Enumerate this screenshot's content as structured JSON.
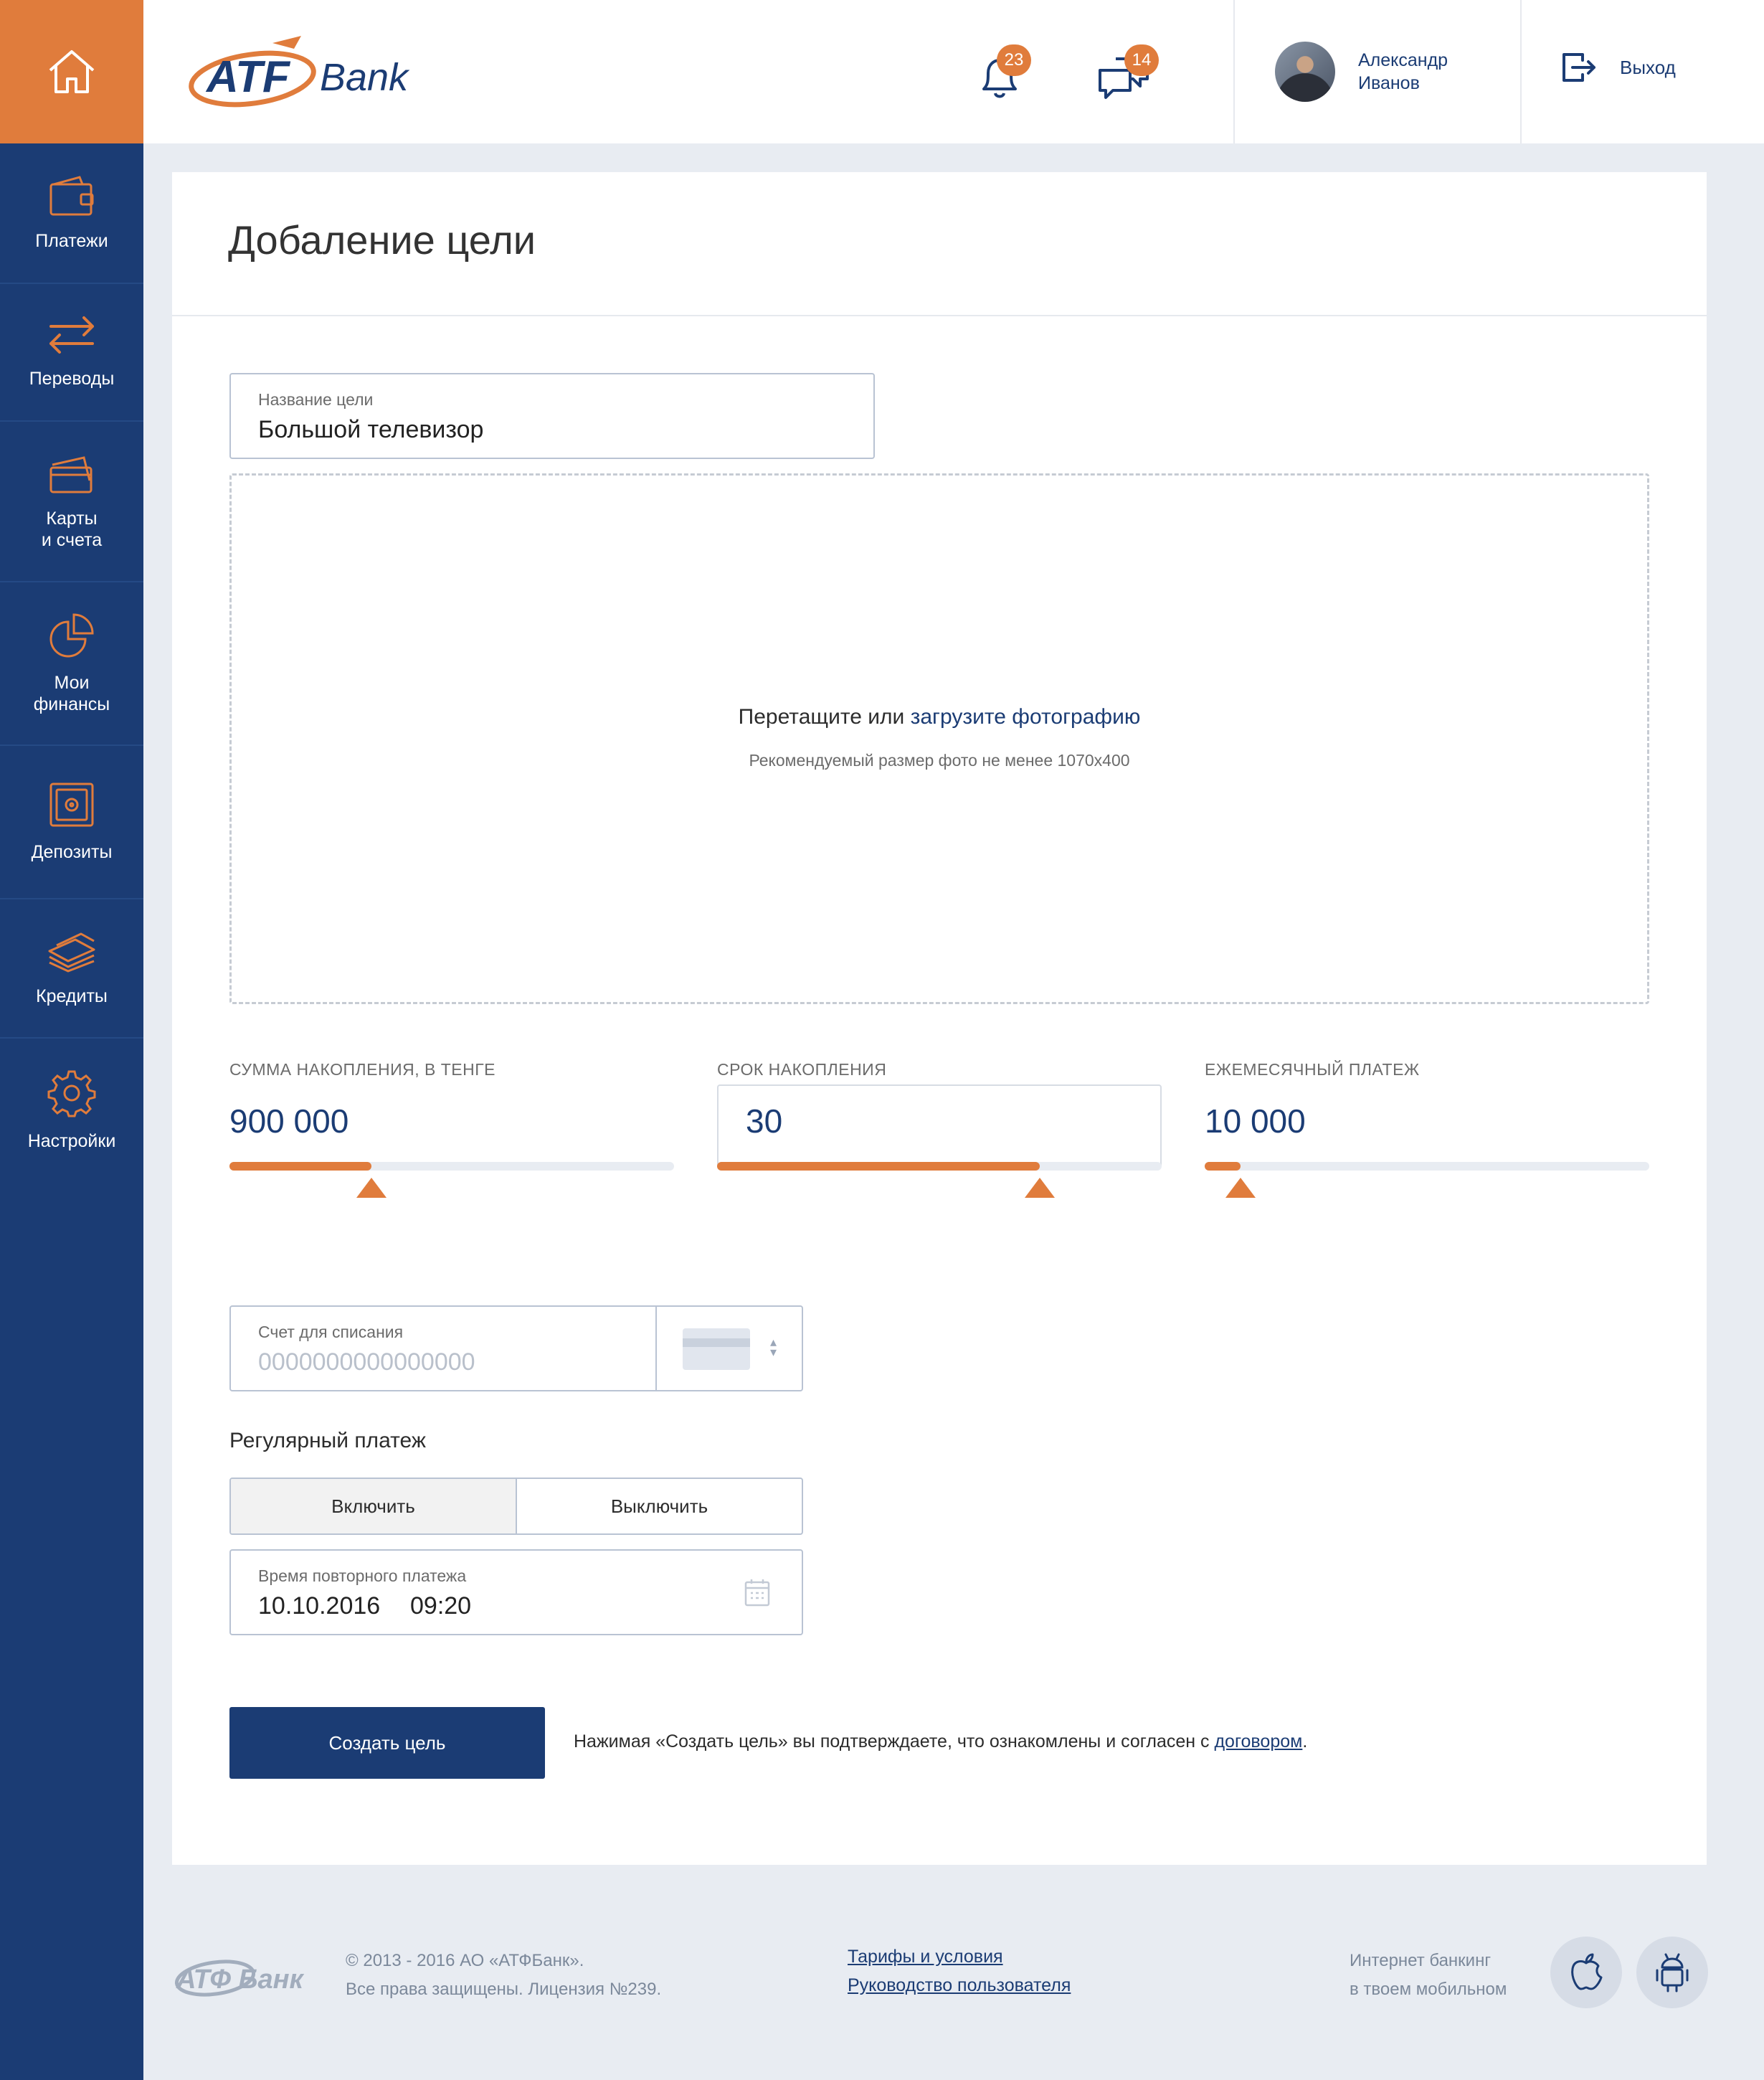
{
  "brand": {
    "logo_text_left": "ATF",
    "logo_text_right": "Bank",
    "footer_logo_text": "АТФ Банк"
  },
  "colors": {
    "primary": "#1b3c74",
    "accent": "#e07c3c",
    "background": "#e8ecf2"
  },
  "sidebar": {
    "home_icon": "home-icon",
    "items": [
      {
        "label": "Платежи",
        "icon": "wallet-icon"
      },
      {
        "label": "Переводы",
        "icon": "transfer-arrows-icon"
      },
      {
        "label": "Карты\nи счета",
        "icon": "cards-icon"
      },
      {
        "label": "Мои\nфинансы",
        "icon": "pie-chart-icon"
      },
      {
        "label": "Депозиты",
        "icon": "safe-icon"
      },
      {
        "label": "Кредиты",
        "icon": "money-stack-icon"
      },
      {
        "label": "Настройки",
        "icon": "gear-icon"
      }
    ]
  },
  "header": {
    "notifications_count": "23",
    "messages_count": "14",
    "user_name": "Александр\nИванов",
    "logout_label": "Выход"
  },
  "form": {
    "title": "Добаление цели",
    "goal_name": {
      "label": "Название цели",
      "value": "Большой телевизор"
    },
    "upload": {
      "text_prefix": "Перетащите или ",
      "link_text": "загрузите фотографию",
      "hint": "Рекомендуемый размер фото не менее 1070x400"
    },
    "sliders": [
      {
        "label": "СУММА НАКОПЛЕНИЯ, В ТЕНГЕ",
        "value": "900 000",
        "fill_percent": 32
      },
      {
        "label": "СРОК НАКОПЛЕНИЯ",
        "value": "30",
        "fill_percent": 72.5
      },
      {
        "label": "ЕЖЕМЕСЯЧНЫЙ ПЛАТЕЖ",
        "value": "10 000",
        "fill_percent": 8
      }
    ],
    "account": {
      "label": "Счет для списания",
      "placeholder": "0000000000000000"
    },
    "regular_payment": {
      "title": "Регулярный платеж",
      "on_label": "Включить",
      "off_label": "Выключить",
      "selected": "Включить"
    },
    "repeat_time": {
      "label": "Время повторного платежа",
      "date": "10.10.2016",
      "time": "09:20"
    },
    "submit_label": "Создать цель",
    "agreement_text": "Нажимая «Создать цель» вы подтверждаете, что ознакомлены и согласен с ",
    "agreement_link": "договором",
    "agreement_end": "."
  },
  "footer": {
    "copyright": "© 2013 - 2016 АО «АТФБанк».\nВсе права защищены. Лицензия №239.",
    "links": [
      "Тарифы и условия",
      "Руководство пользователя"
    ],
    "app_text": "Интернет банкинг\nв твоем мобильном",
    "stores": [
      "apple-icon",
      "android-icon"
    ]
  }
}
